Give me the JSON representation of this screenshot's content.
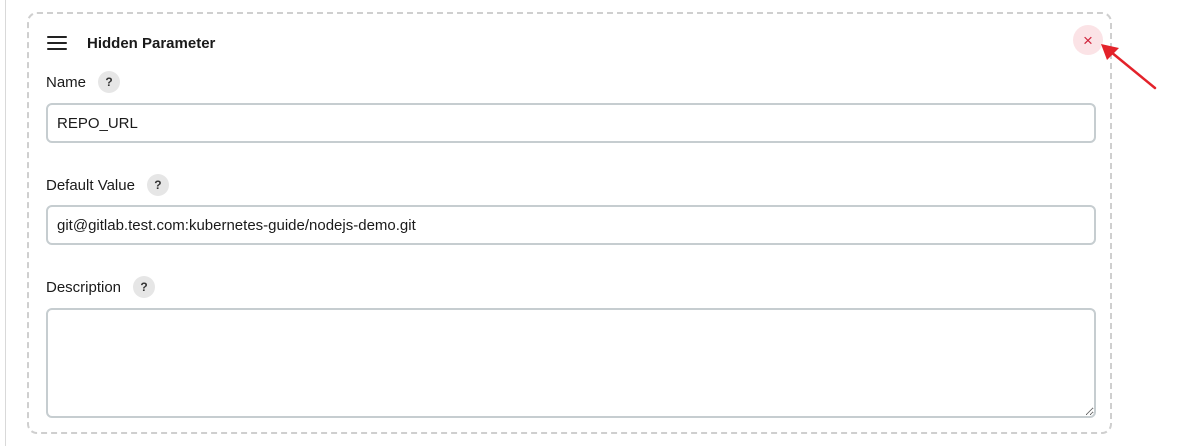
{
  "parameter": {
    "title": "Hidden Parameter",
    "close_symbol": "×",
    "icons": {
      "drag": "hamburger-menu-icon",
      "close": "close-icon",
      "help": "question-mark-icon"
    }
  },
  "fields": {
    "name": {
      "label": "Name",
      "help": "?",
      "value": "REPO_URL"
    },
    "default_value": {
      "label": "Default Value",
      "help": "?",
      "value": "git@gitlab.test.com:kubernetes-guide/nodejs-demo.git"
    },
    "description": {
      "label": "Description",
      "help": "?",
      "value": ""
    }
  },
  "colors": {
    "close_bg": "#fbe3e6",
    "close_fg": "#d0243b",
    "annotation_arrow": "#e3222a",
    "input_border": "#c6cdd0",
    "card_border": "#cfcfcf"
  }
}
